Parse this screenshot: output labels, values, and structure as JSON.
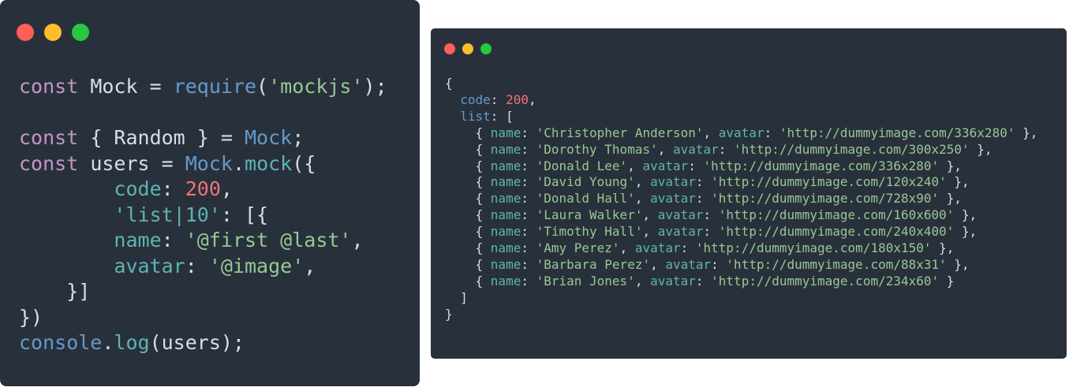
{
  "colors": {
    "red": "#ff5f56",
    "yellow": "#ffbd2e",
    "green": "#27c93f",
    "background": "#28313b"
  },
  "left_code": [
    [
      [
        "kw",
        "const"
      ],
      [
        "pl",
        " Mock = "
      ],
      [
        "fn",
        "require"
      ],
      [
        "pl",
        "("
      ],
      [
        "str",
        "'mockjs'"
      ],
      [
        "pl",
        ");"
      ]
    ],
    [],
    [
      [
        "kw",
        "const"
      ],
      [
        "pl",
        " { Random } = "
      ],
      [
        "fn",
        "Mock"
      ],
      [
        "pl",
        ";"
      ]
    ],
    [
      [
        "kw",
        "const"
      ],
      [
        "pl",
        " users = "
      ],
      [
        "fn",
        "Mock"
      ],
      [
        "pl",
        "."
      ],
      [
        "prop",
        "mock"
      ],
      [
        "pl",
        "({"
      ]
    ],
    [
      [
        "pl",
        "        "
      ],
      [
        "prop",
        "code"
      ],
      [
        "pl",
        ": "
      ],
      [
        "num",
        "200"
      ],
      [
        "pl",
        ","
      ]
    ],
    [
      [
        "pl",
        "        "
      ],
      [
        "prop",
        "'list|10'"
      ],
      [
        "pl",
        ": [{"
      ]
    ],
    [
      [
        "pl",
        "        "
      ],
      [
        "prop",
        "name"
      ],
      [
        "pl",
        ": "
      ],
      [
        "str",
        "'@first @last'"
      ],
      [
        "pl",
        ","
      ]
    ],
    [
      [
        "pl",
        "        "
      ],
      [
        "prop",
        "avatar"
      ],
      [
        "pl",
        ": "
      ],
      [
        "str",
        "'@image'"
      ],
      [
        "pl",
        ","
      ]
    ],
    [
      [
        "pl",
        "    }]"
      ]
    ],
    [
      [
        "pl",
        "})"
      ]
    ],
    [
      [
        "fn",
        "console"
      ],
      [
        "pl",
        "."
      ],
      [
        "prop",
        "log"
      ],
      [
        "pl",
        "(users);"
      ]
    ]
  ],
  "right_code": [
    [
      [
        "pl",
        "{"
      ]
    ],
    [
      [
        "pl",
        "  "
      ],
      [
        "key",
        "code"
      ],
      [
        "pl",
        ": "
      ],
      [
        "num",
        "200"
      ],
      [
        "pl",
        ","
      ]
    ],
    [
      [
        "pl",
        "  "
      ],
      [
        "key",
        "list"
      ],
      [
        "pl",
        ": ["
      ]
    ],
    [
      [
        "pl",
        "    { "
      ],
      [
        "prop",
        "name"
      ],
      [
        "pl",
        ": "
      ],
      [
        "str",
        "'Christopher Anderson'"
      ],
      [
        "pl",
        ", "
      ],
      [
        "prop",
        "avatar"
      ],
      [
        "pl",
        ": "
      ],
      [
        "str",
        "'http://dummyimage.com/336x280'"
      ],
      [
        "pl",
        " },"
      ]
    ],
    [
      [
        "pl",
        "    { "
      ],
      [
        "prop",
        "name"
      ],
      [
        "pl",
        ": "
      ],
      [
        "str",
        "'Dorothy Thomas'"
      ],
      [
        "pl",
        ", "
      ],
      [
        "prop",
        "avatar"
      ],
      [
        "pl",
        ": "
      ],
      [
        "str",
        "'http://dummyimage.com/300x250'"
      ],
      [
        "pl",
        " },"
      ]
    ],
    [
      [
        "pl",
        "    { "
      ],
      [
        "prop",
        "name"
      ],
      [
        "pl",
        ": "
      ],
      [
        "str",
        "'Donald Lee'"
      ],
      [
        "pl",
        ", "
      ],
      [
        "prop",
        "avatar"
      ],
      [
        "pl",
        ": "
      ],
      [
        "str",
        "'http://dummyimage.com/336x280'"
      ],
      [
        "pl",
        " },"
      ]
    ],
    [
      [
        "pl",
        "    { "
      ],
      [
        "prop",
        "name"
      ],
      [
        "pl",
        ": "
      ],
      [
        "str",
        "'David Young'"
      ],
      [
        "pl",
        ", "
      ],
      [
        "prop",
        "avatar"
      ],
      [
        "pl",
        ": "
      ],
      [
        "str",
        "'http://dummyimage.com/120x240'"
      ],
      [
        "pl",
        " },"
      ]
    ],
    [
      [
        "pl",
        "    { "
      ],
      [
        "prop",
        "name"
      ],
      [
        "pl",
        ": "
      ],
      [
        "str",
        "'Donald Hall'"
      ],
      [
        "pl",
        ", "
      ],
      [
        "prop",
        "avatar"
      ],
      [
        "pl",
        ": "
      ],
      [
        "str",
        "'http://dummyimage.com/728x90'"
      ],
      [
        "pl",
        " },"
      ]
    ],
    [
      [
        "pl",
        "    { "
      ],
      [
        "prop",
        "name"
      ],
      [
        "pl",
        ": "
      ],
      [
        "str",
        "'Laura Walker'"
      ],
      [
        "pl",
        ", "
      ],
      [
        "prop",
        "avatar"
      ],
      [
        "pl",
        ": "
      ],
      [
        "str",
        "'http://dummyimage.com/160x600'"
      ],
      [
        "pl",
        " },"
      ]
    ],
    [
      [
        "pl",
        "    { "
      ],
      [
        "prop",
        "name"
      ],
      [
        "pl",
        ": "
      ],
      [
        "str",
        "'Timothy Hall'"
      ],
      [
        "pl",
        ", "
      ],
      [
        "prop",
        "avatar"
      ],
      [
        "pl",
        ": "
      ],
      [
        "str",
        "'http://dummyimage.com/240x400'"
      ],
      [
        "pl",
        " },"
      ]
    ],
    [
      [
        "pl",
        "    { "
      ],
      [
        "prop",
        "name"
      ],
      [
        "pl",
        ": "
      ],
      [
        "str",
        "'Amy Perez'"
      ],
      [
        "pl",
        ", "
      ],
      [
        "prop",
        "avatar"
      ],
      [
        "pl",
        ": "
      ],
      [
        "str",
        "'http://dummyimage.com/180x150'"
      ],
      [
        "pl",
        " },"
      ]
    ],
    [
      [
        "pl",
        "    { "
      ],
      [
        "prop",
        "name"
      ],
      [
        "pl",
        ": "
      ],
      [
        "str",
        "'Barbara Perez'"
      ],
      [
        "pl",
        ", "
      ],
      [
        "prop",
        "avatar"
      ],
      [
        "pl",
        ": "
      ],
      [
        "str",
        "'http://dummyimage.com/88x31'"
      ],
      [
        "pl",
        " },"
      ]
    ],
    [
      [
        "pl",
        "    { "
      ],
      [
        "prop",
        "name"
      ],
      [
        "pl",
        ": "
      ],
      [
        "str",
        "'Brian Jones'"
      ],
      [
        "pl",
        ", "
      ],
      [
        "prop",
        "avatar"
      ],
      [
        "pl",
        ": "
      ],
      [
        "str",
        "'http://dummyimage.com/234x60'"
      ],
      [
        "pl",
        " }"
      ]
    ],
    [
      [
        "pl",
        "  ]"
      ]
    ],
    [
      [
        "pl",
        "}"
      ]
    ]
  ]
}
